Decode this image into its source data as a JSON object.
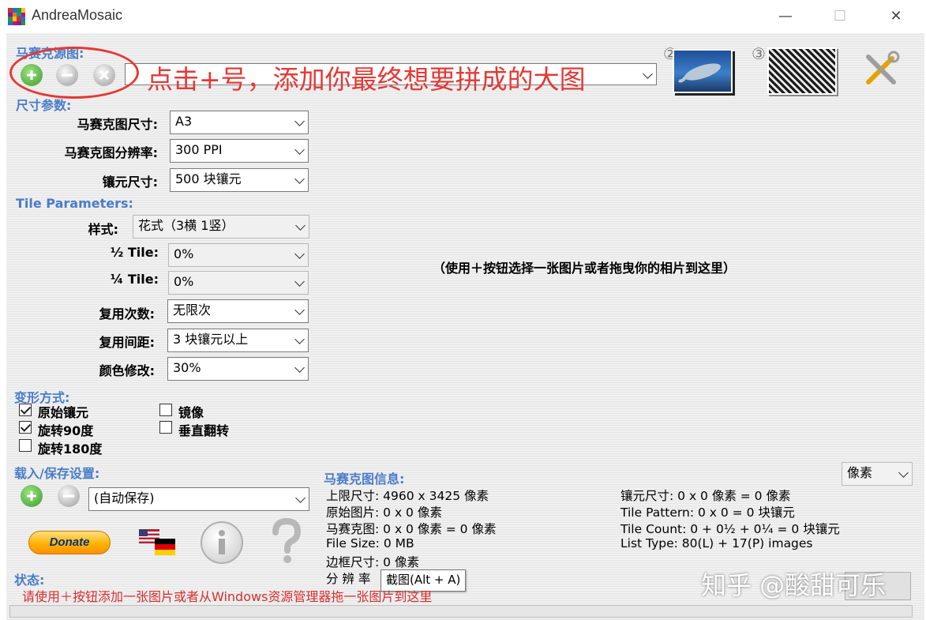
{
  "window": {
    "title": "AndreaMosaic",
    "minimize": "—",
    "maximize": "☐",
    "close": "✕"
  },
  "source": {
    "heading": "马赛克源图:",
    "annotation": "点击+号，添加你最终想要拼成的大图",
    "step2": "②",
    "step3": "③"
  },
  "size_params": {
    "heading": "尺寸参数:",
    "rows": [
      {
        "label": "马赛克图尺寸:",
        "value": "A3"
      },
      {
        "label": "马赛克图分辨率:",
        "value": "300 PPI"
      },
      {
        "label": "镶元尺寸:",
        "value": "500 块镶元"
      }
    ]
  },
  "tile_params": {
    "heading": "Tile Parameters:",
    "style": {
      "label": "样式:",
      "value": "花式（3横 1竖）"
    },
    "half": {
      "label": "½ Tile:",
      "value": "0%"
    },
    "quarter": {
      "label": "¼ Tile:",
      "value": "0%"
    },
    "reuse": {
      "label": "复用次数:",
      "value": "无限次"
    },
    "distance": {
      "label": "复用间距:",
      "value": "3 块镶元以上"
    },
    "color": {
      "label": "颜色修改:",
      "value": "30%"
    }
  },
  "preview_hint": "（使用＋按钮选择一张图片或者拖曳你的相片到这里）",
  "transform": {
    "heading": "变形方式:",
    "original": {
      "label": "原始镶元",
      "checked": true
    },
    "rot90": {
      "label": "旋转90度",
      "checked": true
    },
    "rot180": {
      "label": "旋转180度",
      "checked": false
    },
    "mirror": {
      "label": "镜像",
      "checked": false
    },
    "vflip": {
      "label": "垂直翻转",
      "checked": false
    }
  },
  "load_save": {
    "heading": "载入/保存设置:",
    "value": "(自动保存)"
  },
  "donate": "Donate",
  "info": {
    "heading": "马赛克图信息:",
    "unit": "像素",
    "left": [
      "上限尺寸: 4960 x 3425 像素",
      "原始图片: 0 x 0 像素",
      "马赛克图: 0 x 0 像素 = 0 像素",
      "File Size: 0 MB",
      "边框尺寸: 0 像素",
      "分 辨 率"
    ],
    "right": [
      "镶元尺寸: 0 x 0 像素 = 0 像素",
      "Tile Pattern: 0 x 0 = 0 块镶元",
      "Tile Count: 0 + 0½ + 0¼ = 0 块镶元",
      "List Type: 80(L) + 17(P) images"
    ],
    "tooltip": "截图(Alt + A)"
  },
  "status": {
    "heading": "状态:",
    "text": "请使用＋按钮添加一张图片或者从Windows资源管理器拖一张图片到这里"
  },
  "watermark": "知乎 @酸甜可乐",
  "colors": {
    "section": "#4a7cc9",
    "annotation": "#e53935",
    "status": "#d32f2f",
    "plus": "#4caf50"
  }
}
